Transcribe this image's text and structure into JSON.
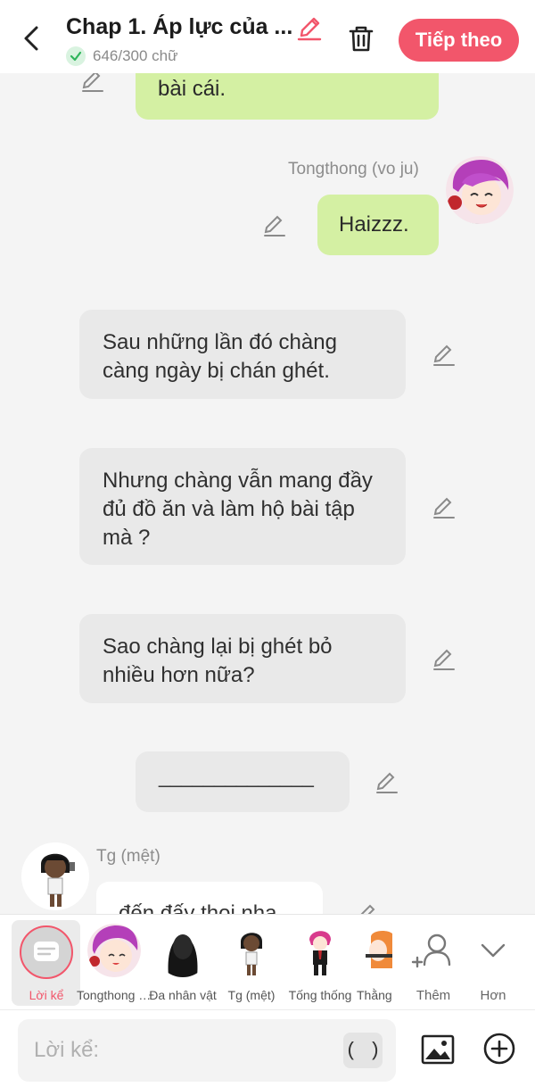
{
  "header": {
    "title": "Chap 1. Áp lực của ...",
    "word_count": "646/300 chữ",
    "next_label": "Tiếp theo"
  },
  "messages": [
    {
      "type": "right",
      "text": "bài cái."
    },
    {
      "type": "right",
      "sender": "Tongthong (vo ju)",
      "text": "Haizzz."
    },
    {
      "type": "narration",
      "text": "Sau những lần đó chàng càng ngày bị chán ghét."
    },
    {
      "type": "narration",
      "text": "Nhưng chàng vẫn mang đầy đủ đồ ăn và làm hộ bài tập mà ?"
    },
    {
      "type": "narration",
      "text": "Sao chàng lại bị ghét bỏ nhiều hơn nữa?"
    },
    {
      "type": "narration",
      "text": "______________"
    },
    {
      "type": "left",
      "sender": "Tg (mệt)",
      "text": "đến đấy thoi nha"
    }
  ],
  "characters": [
    {
      "label": "Lời kể",
      "selected": true
    },
    {
      "label": "Tongthong (vo ju)"
    },
    {
      "label": "Đa nhân vật"
    },
    {
      "label": "Tg (mệt)"
    },
    {
      "label": "Tống thống"
    },
    {
      "label": "Thằng"
    }
  ],
  "more": {
    "add_label": "Thêm",
    "expand_label": "Hơn"
  },
  "input": {
    "placeholder": "Lời kể:",
    "paren_label": "( )"
  },
  "colors": {
    "accent": "#f2566b",
    "green_bubble": "#d4f0a3",
    "gray_bubble": "#e9e9e9"
  }
}
